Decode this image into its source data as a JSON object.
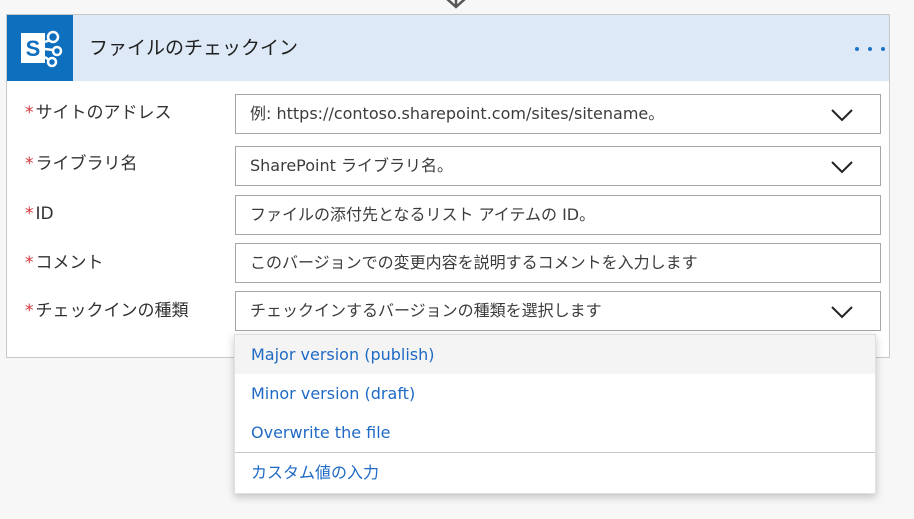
{
  "card": {
    "title": "ファイルのチェックイン",
    "app_icon": "sharepoint-icon",
    "more_icon": "more-horizontal-icon"
  },
  "fields": [
    {
      "name": "site-address",
      "label": "サイトのアドレス",
      "placeholder": "例: https://contoso.sharepoint.com/sites/sitename。",
      "has_dropdown": true
    },
    {
      "name": "library-name",
      "label": "ライブラリ名",
      "placeholder": "SharePoint ライブラリ名。",
      "has_dropdown": true
    },
    {
      "name": "id",
      "label": "ID",
      "placeholder": "ファイルの添付先となるリスト アイテムの ID。",
      "has_dropdown": false
    },
    {
      "name": "comment",
      "label": "コメント",
      "placeholder": "このバージョンでの変更内容を説明するコメントを入力します",
      "has_dropdown": false
    },
    {
      "name": "checkin-type",
      "label": "チェックインの種類",
      "placeholder": "チェックインするバージョンの種類を選択します",
      "has_dropdown": true
    }
  ],
  "required_marker": "*",
  "dropdown": {
    "options": [
      "Major version (publish)",
      "Minor version (draft)",
      "Overwrite the file"
    ],
    "custom_value": "カスタム値の入力"
  },
  "colors": {
    "accent": "#1f6ac4",
    "header_bg": "#dde9f6",
    "icon_bg": "#0f6fbf",
    "required": "#d13438"
  }
}
